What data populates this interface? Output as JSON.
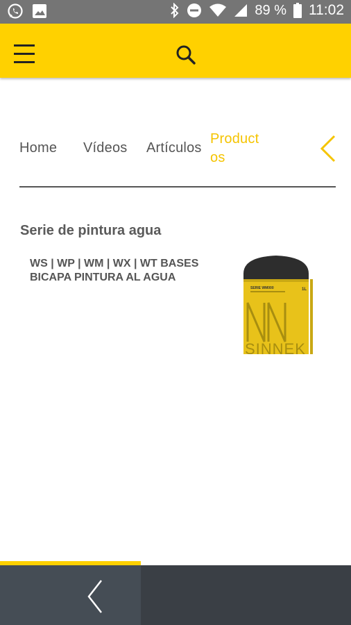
{
  "status_bar": {
    "battery": "89 %",
    "time": "11:02",
    "icons": [
      "whatsapp-icon",
      "image-icon",
      "bluetooth-icon",
      "do-not-disturb-icon",
      "wifi-icon",
      "signal-icon",
      "battery-icon"
    ]
  },
  "header": {
    "menu_icon": "hamburger-icon",
    "search_icon": "search-icon",
    "color": "#FFD100"
  },
  "tabs": {
    "items": [
      {
        "label": "Home"
      },
      {
        "label": "Vídeos"
      },
      {
        "label": "Artículos"
      },
      {
        "label": "Product",
        "label_line2": "os",
        "active": true
      }
    ],
    "back_icon": "chevron-left-icon",
    "active_color": "#F5C400"
  },
  "content": {
    "section_title": "Serie de pintura agua",
    "product": {
      "name": "WS | WP | WM | WX | WT BASES BICAPA PINTURA AL AGUA",
      "image_label": "SINNEK",
      "image_small_text": "SERIE WM000",
      "image_badge": "1L"
    }
  },
  "bottom_nav": {
    "back_icon": "chevron-left-icon"
  }
}
